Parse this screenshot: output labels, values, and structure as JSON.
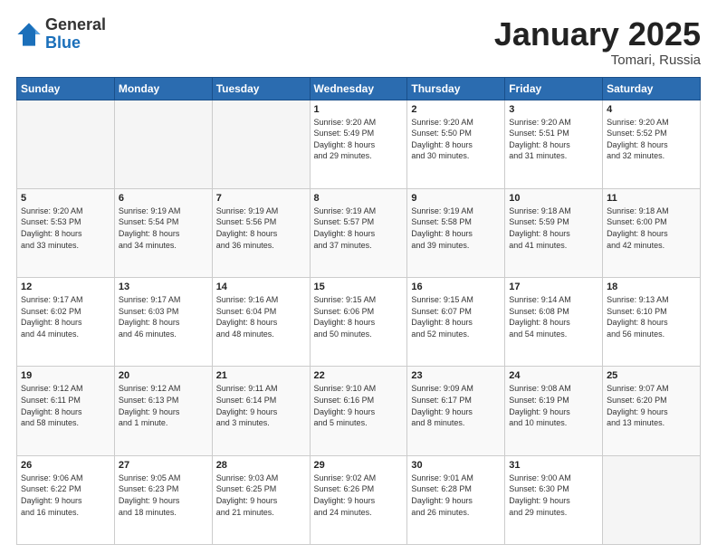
{
  "header": {
    "logo_general": "General",
    "logo_blue": "Blue",
    "month_title": "January 2025",
    "location": "Tomari, Russia"
  },
  "weekdays": [
    "Sunday",
    "Monday",
    "Tuesday",
    "Wednesday",
    "Thursday",
    "Friday",
    "Saturday"
  ],
  "weeks": [
    [
      {
        "day": "",
        "info": ""
      },
      {
        "day": "",
        "info": ""
      },
      {
        "day": "",
        "info": ""
      },
      {
        "day": "1",
        "info": "Sunrise: 9:20 AM\nSunset: 5:49 PM\nDaylight: 8 hours\nand 29 minutes."
      },
      {
        "day": "2",
        "info": "Sunrise: 9:20 AM\nSunset: 5:50 PM\nDaylight: 8 hours\nand 30 minutes."
      },
      {
        "day": "3",
        "info": "Sunrise: 9:20 AM\nSunset: 5:51 PM\nDaylight: 8 hours\nand 31 minutes."
      },
      {
        "day": "4",
        "info": "Sunrise: 9:20 AM\nSunset: 5:52 PM\nDaylight: 8 hours\nand 32 minutes."
      }
    ],
    [
      {
        "day": "5",
        "info": "Sunrise: 9:20 AM\nSunset: 5:53 PM\nDaylight: 8 hours\nand 33 minutes."
      },
      {
        "day": "6",
        "info": "Sunrise: 9:19 AM\nSunset: 5:54 PM\nDaylight: 8 hours\nand 34 minutes."
      },
      {
        "day": "7",
        "info": "Sunrise: 9:19 AM\nSunset: 5:56 PM\nDaylight: 8 hours\nand 36 minutes."
      },
      {
        "day": "8",
        "info": "Sunrise: 9:19 AM\nSunset: 5:57 PM\nDaylight: 8 hours\nand 37 minutes."
      },
      {
        "day": "9",
        "info": "Sunrise: 9:19 AM\nSunset: 5:58 PM\nDaylight: 8 hours\nand 39 minutes."
      },
      {
        "day": "10",
        "info": "Sunrise: 9:18 AM\nSunset: 5:59 PM\nDaylight: 8 hours\nand 41 minutes."
      },
      {
        "day": "11",
        "info": "Sunrise: 9:18 AM\nSunset: 6:00 PM\nDaylight: 8 hours\nand 42 minutes."
      }
    ],
    [
      {
        "day": "12",
        "info": "Sunrise: 9:17 AM\nSunset: 6:02 PM\nDaylight: 8 hours\nand 44 minutes."
      },
      {
        "day": "13",
        "info": "Sunrise: 9:17 AM\nSunset: 6:03 PM\nDaylight: 8 hours\nand 46 minutes."
      },
      {
        "day": "14",
        "info": "Sunrise: 9:16 AM\nSunset: 6:04 PM\nDaylight: 8 hours\nand 48 minutes."
      },
      {
        "day": "15",
        "info": "Sunrise: 9:15 AM\nSunset: 6:06 PM\nDaylight: 8 hours\nand 50 minutes."
      },
      {
        "day": "16",
        "info": "Sunrise: 9:15 AM\nSunset: 6:07 PM\nDaylight: 8 hours\nand 52 minutes."
      },
      {
        "day": "17",
        "info": "Sunrise: 9:14 AM\nSunset: 6:08 PM\nDaylight: 8 hours\nand 54 minutes."
      },
      {
        "day": "18",
        "info": "Sunrise: 9:13 AM\nSunset: 6:10 PM\nDaylight: 8 hours\nand 56 minutes."
      }
    ],
    [
      {
        "day": "19",
        "info": "Sunrise: 9:12 AM\nSunset: 6:11 PM\nDaylight: 8 hours\nand 58 minutes."
      },
      {
        "day": "20",
        "info": "Sunrise: 9:12 AM\nSunset: 6:13 PM\nDaylight: 9 hours\nand 1 minute."
      },
      {
        "day": "21",
        "info": "Sunrise: 9:11 AM\nSunset: 6:14 PM\nDaylight: 9 hours\nand 3 minutes."
      },
      {
        "day": "22",
        "info": "Sunrise: 9:10 AM\nSunset: 6:16 PM\nDaylight: 9 hours\nand 5 minutes."
      },
      {
        "day": "23",
        "info": "Sunrise: 9:09 AM\nSunset: 6:17 PM\nDaylight: 9 hours\nand 8 minutes."
      },
      {
        "day": "24",
        "info": "Sunrise: 9:08 AM\nSunset: 6:19 PM\nDaylight: 9 hours\nand 10 minutes."
      },
      {
        "day": "25",
        "info": "Sunrise: 9:07 AM\nSunset: 6:20 PM\nDaylight: 9 hours\nand 13 minutes."
      }
    ],
    [
      {
        "day": "26",
        "info": "Sunrise: 9:06 AM\nSunset: 6:22 PM\nDaylight: 9 hours\nand 16 minutes."
      },
      {
        "day": "27",
        "info": "Sunrise: 9:05 AM\nSunset: 6:23 PM\nDaylight: 9 hours\nand 18 minutes."
      },
      {
        "day": "28",
        "info": "Sunrise: 9:03 AM\nSunset: 6:25 PM\nDaylight: 9 hours\nand 21 minutes."
      },
      {
        "day": "29",
        "info": "Sunrise: 9:02 AM\nSunset: 6:26 PM\nDaylight: 9 hours\nand 24 minutes."
      },
      {
        "day": "30",
        "info": "Sunrise: 9:01 AM\nSunset: 6:28 PM\nDaylight: 9 hours\nand 26 minutes."
      },
      {
        "day": "31",
        "info": "Sunrise: 9:00 AM\nSunset: 6:30 PM\nDaylight: 9 hours\nand 29 minutes."
      },
      {
        "day": "",
        "info": ""
      }
    ]
  ]
}
